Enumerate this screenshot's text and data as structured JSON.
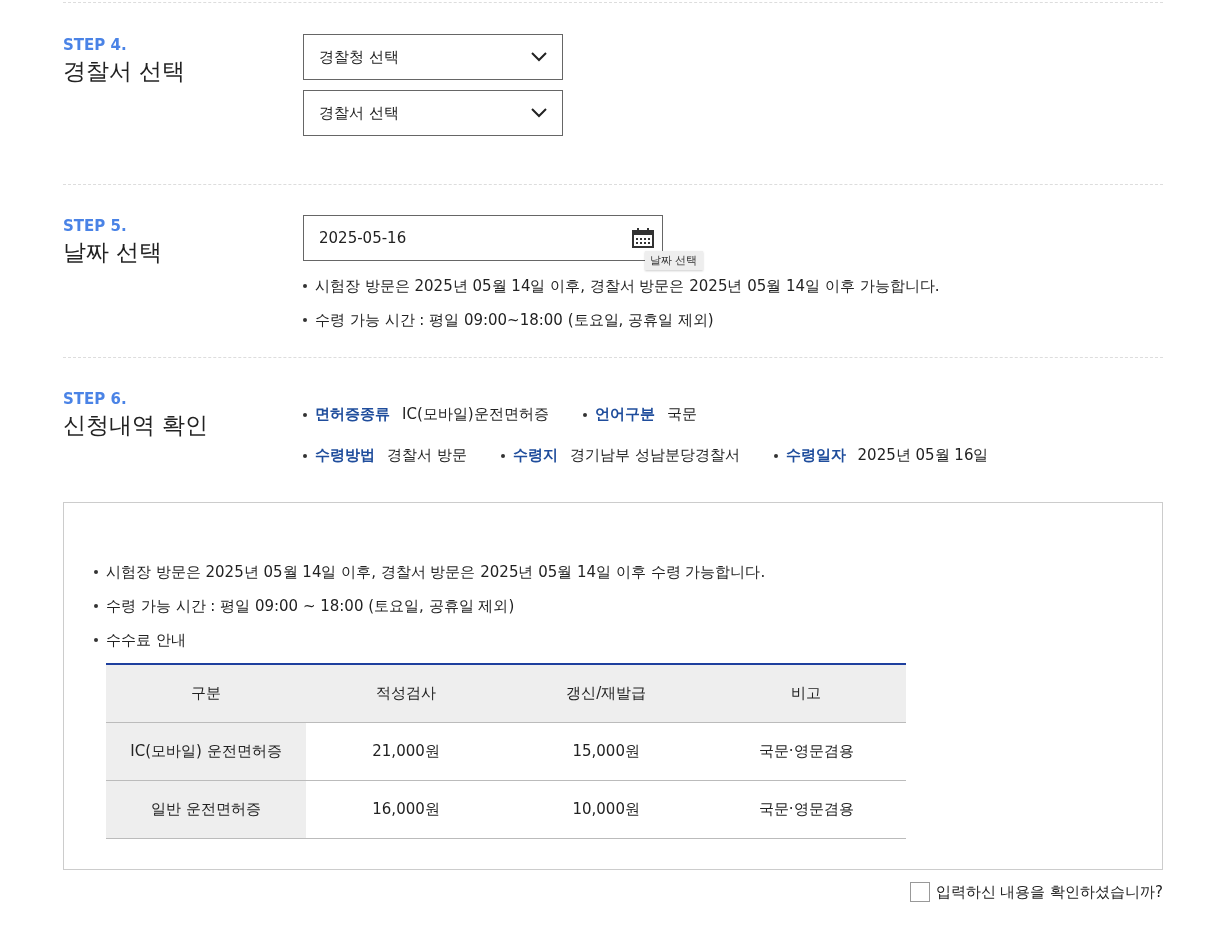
{
  "steps": [
    {
      "kind": "selects",
      "step": "STEP 4.",
      "title": "경찰서 선택",
      "selects": [
        {
          "value": "경찰청 선택"
        },
        {
          "value": "경찰서 선택"
        }
      ]
    },
    {
      "kind": "date",
      "step": "STEP 5.",
      "title": "날짜 선택",
      "date": {
        "value": "2025-05-16",
        "tooltip": "날짜 선택"
      },
      "notes": [
        "시험장 방문은 2025년 05월 14일 이후, 경찰서 방문은 2025년 05월 14일 이후 가능합니다.",
        "수령 가능 시간 : 평일 09:00~18:00 (토요일, 공휴일 제외)"
      ]
    },
    {
      "kind": "summary",
      "step": "STEP 6.",
      "title": "신청내역 확인",
      "summary_rows": [
        [
          {
            "label": "면허증종류",
            "value": "IC(모바일)운전면허증"
          },
          {
            "label": "언어구분",
            "value": "국문"
          }
        ],
        [
          {
            "label": "수령방법",
            "value": "경찰서 방문"
          },
          {
            "label": "수령지",
            "value": "경기남부 성남분당경찰서"
          },
          {
            "label": "수령일자",
            "value": "2025년 05월 16일"
          }
        ]
      ]
    }
  ],
  "info_box": {
    "notes": [
      "시험장 방문은 2025년 05월 14일 이후, 경찰서 방문은 2025년 05월 14일 이후 수령 가능합니다.",
      "수령 가능 시간 : 평일 09:00 ~ 18:00 (토요일, 공휴일 제외)",
      "수수료 안내"
    ],
    "table": {
      "columns": [
        "구분",
        "적성검사",
        "갱신/재발급",
        "비고"
      ],
      "rows": [
        [
          "IC(모바일) 운전면허증",
          "21,000원",
          "15,000원",
          "국문·영문겸용"
        ],
        [
          "일반 운전면허증",
          "16,000원",
          "10,000원",
          "국문·영문겸용"
        ]
      ]
    }
  },
  "confirm": {
    "label": "입력하신 내용을 확인하셨습니까?",
    "checked": false
  }
}
